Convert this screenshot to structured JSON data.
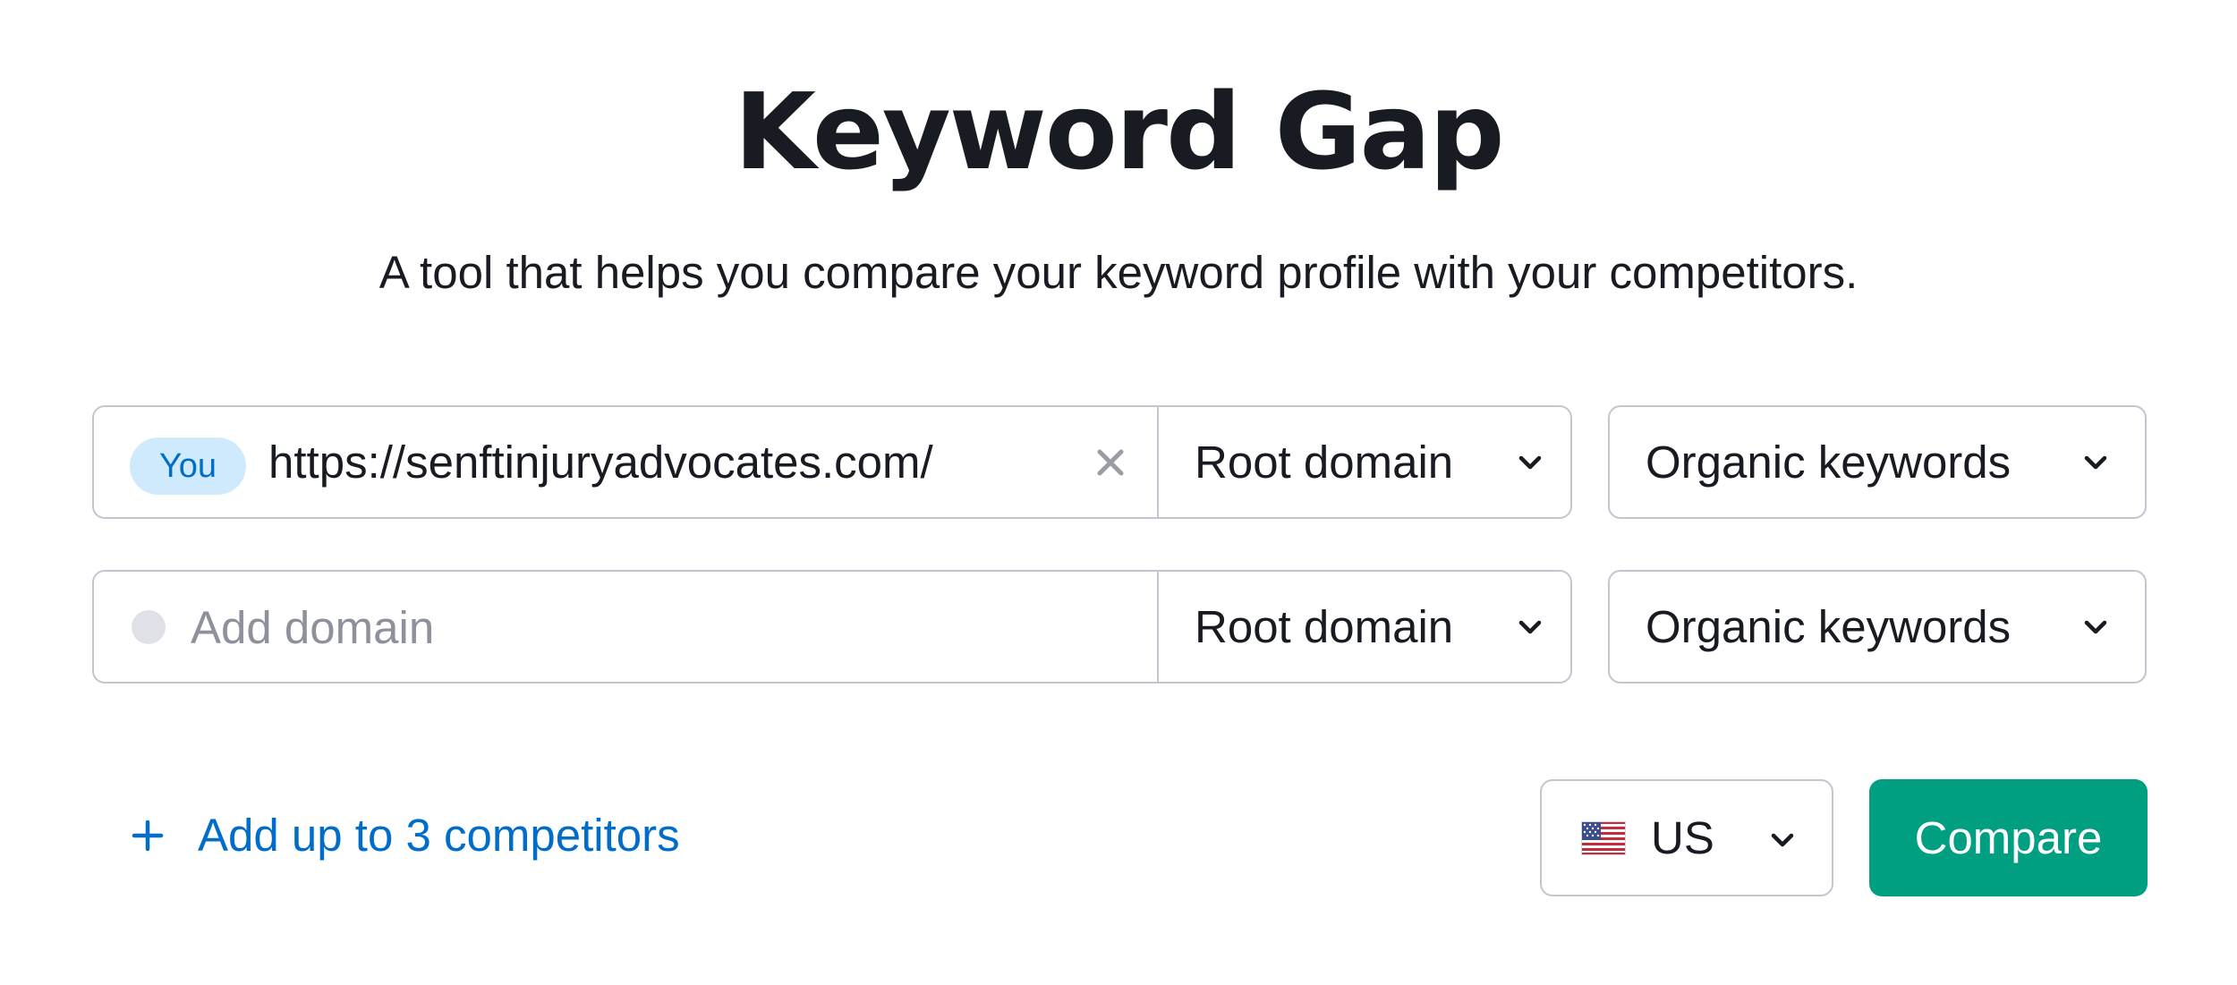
{
  "header": {
    "title": "Keyword Gap",
    "subtitle": "A tool that helps you compare your keyword profile with your competitors."
  },
  "rows": [
    {
      "badge": "You",
      "domain": "https://senftinjuryadvocates.com/",
      "scope": "Root domain",
      "keyword_type": "Organic keywords",
      "clear_icon": "close-icon"
    },
    {
      "placeholder": "Add domain",
      "scope": "Root domain",
      "keyword_type": "Organic keywords"
    }
  ],
  "add_competitors": {
    "icon": "plus-icon",
    "label": "Add up to 3 competitors"
  },
  "country": {
    "icon": "us-flag-icon",
    "value": "US"
  },
  "compare_button": {
    "label": "Compare"
  },
  "colors": {
    "accent": "#009f81",
    "link": "#006dca",
    "badge_bg": "#cfeafd",
    "border": "#c2c6cf",
    "text": "#191b23",
    "placeholder": "#8e919b"
  }
}
